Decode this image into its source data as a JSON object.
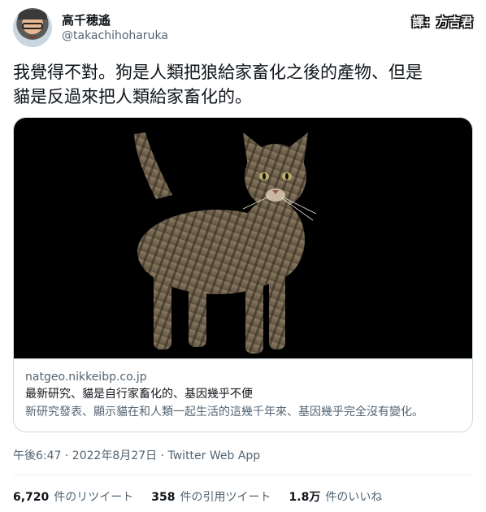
{
  "author": {
    "name": "高千穂遙",
    "handle": "@takachihoharuka"
  },
  "translator_credit": "譯：方吉君",
  "tweet": {
    "line1": "我覺得不對。狗是人類把狼給家畜化之後的產物、但是",
    "line2": "貓是反過來把人類給家畜化的。"
  },
  "card": {
    "image_alt": "tabby cat standing on black background",
    "domain": "natgeo.nikkeibp.co.jp",
    "title": "最新研究、貓是自行家畜化的、基因幾乎不便",
    "description": "新研究發表、顯示貓在和人類一起生活的這幾千年來、基因幾乎完全沒有變化。"
  },
  "timestamp": "午後6:47 · 2022年8月27日 · Twitter Web App",
  "stats": {
    "retweets_count": "6,720",
    "retweets_label": "件のリツイート",
    "quotes_count": "358",
    "quotes_label": "件の引用ツイート",
    "likes_count": "1.8万",
    "likes_label": "件のいいね"
  },
  "colors": {
    "text_primary": "#0f1419",
    "text_secondary": "#536471",
    "border": "#cfd9de"
  }
}
